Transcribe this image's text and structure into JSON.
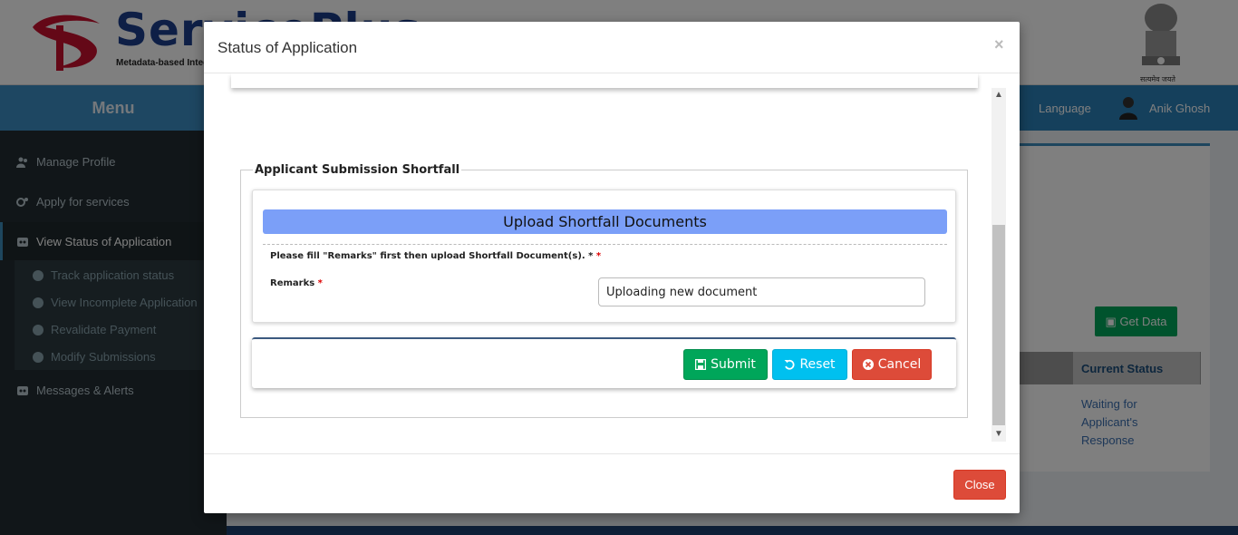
{
  "header": {
    "brand": "ServicePlus",
    "tagline": "Metadata-based Integrated eService Delivery Framework",
    "emblem_caption": "सत्यमेव जयते"
  },
  "topnav": {
    "menu_title": "Menu",
    "language": "Language",
    "user_name": "Anik Ghosh"
  },
  "sidebar": {
    "items": [
      {
        "label": "Manage Profile",
        "icon": "users-icon"
      },
      {
        "label": "Apply for services",
        "icon": "cogs-icon"
      },
      {
        "label": "View Status of Application",
        "icon": "status-icon"
      },
      {
        "label": "Messages & Alerts",
        "icon": "messages-icon"
      }
    ],
    "subitems": [
      {
        "label": "Track application status"
      },
      {
        "label": "View Incomplete Application"
      },
      {
        "label": "Revalidate Payment"
      },
      {
        "label": "Modify Submissions"
      }
    ]
  },
  "background_content": {
    "get_data_label": "Get Data",
    "current_status_header": "Current Status",
    "current_status_value": "Waiting for Applicant's Response"
  },
  "modal": {
    "title": "Status of Application",
    "close_symbol": "×",
    "fieldset_legend": "Applicant Submission Shortfall",
    "upload_heading": "Upload Shortfall Documents",
    "note": "Please fill \"Remarks\" first then upload Shortfall Document(s). *",
    "required_mark": "*",
    "remarks_label": "Remarks",
    "remarks_value": "Uploading new document",
    "buttons": {
      "submit": "Submit",
      "reset": "Reset",
      "cancel": "Cancel"
    },
    "footer_close": "Close"
  },
  "colors": {
    "primary": "#2b80b9",
    "success": "#00a65a",
    "info": "#00c0ef",
    "danger": "#dd4b39",
    "upload_heading_bg": "#7b9ff8"
  }
}
